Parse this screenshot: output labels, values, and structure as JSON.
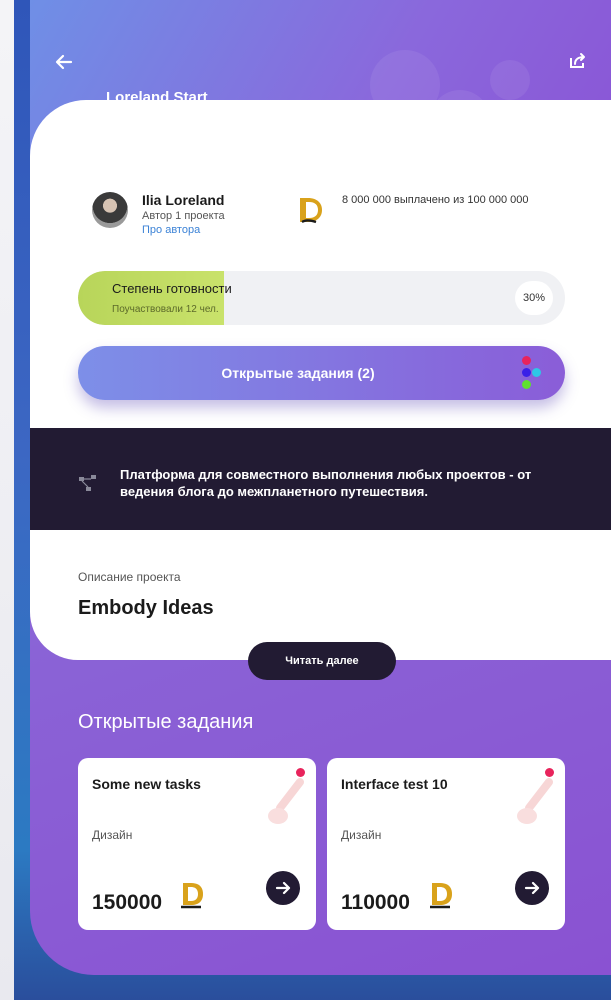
{
  "header": {
    "title": "Loreland Start"
  },
  "author": {
    "name": "Ilia Loreland",
    "role": "Автор 1 проекта",
    "link": "Про автора"
  },
  "funding": {
    "text": "8 000 000 выплачено из 100 000 000"
  },
  "progress": {
    "title": "Степень готовности",
    "participants": "Поучаствовали 12 чел.",
    "percent_label": "30%",
    "value": 0.3
  },
  "tasks_button": {
    "label": "Открытые задания (2)"
  },
  "platform": {
    "text": "Платформа для совместного выполнения любых проектов - от ведения блога до межпланетного путешествия."
  },
  "description": {
    "label": "Описание проекта",
    "title": "Embody Ideas",
    "read_more": "Читать далее"
  },
  "open_tasks": {
    "title": "Открытые задания",
    "items": [
      {
        "title": "Some new tasks",
        "category": "Дизайн",
        "price": "150000"
      },
      {
        "title": "Interface test 10",
        "category": "Дизайн",
        "price": "110000"
      }
    ]
  },
  "colors": {
    "accent_purple": "#8a5dd8",
    "accent_blue": "#7d8fe8",
    "dark": "#221b33",
    "progress_green": "#b8d55a",
    "coin_gold": "#d9a21b",
    "dot_red": "#e8245c"
  },
  "icons": {
    "back": "arrow-left-icon",
    "share": "share-icon",
    "coin": "coin-logo-icon",
    "dots": "colored-dots-icon",
    "platform": "network-icon",
    "arrow": "arrow-right-icon",
    "brush": "brush-icon"
  }
}
